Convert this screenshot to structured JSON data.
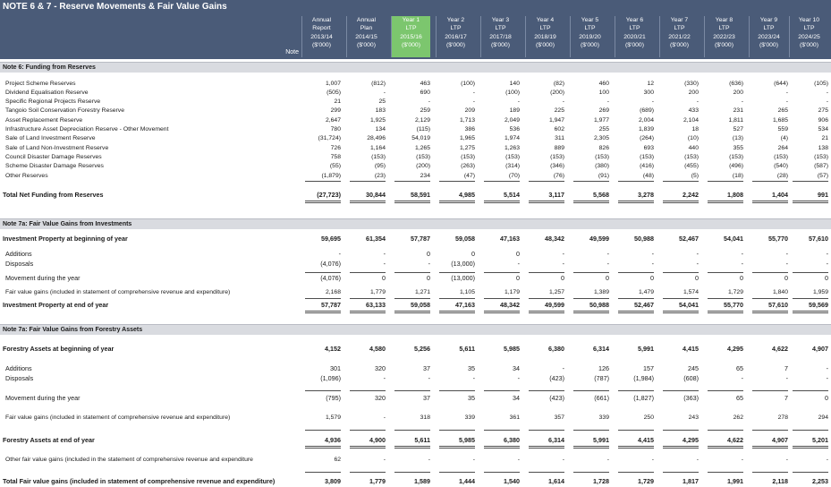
{
  "title": "NOTE 6 & 7 - Reserve Movements & Fair Value Gains",
  "note_header": "Note",
  "columns": [
    {
      "l1": "Annual",
      "l2": "Report",
      "l3": "2013/14",
      "l4": "($'000)"
    },
    {
      "l1": "Annual",
      "l2": "Plan",
      "l3": "2014/15",
      "l4": "($'000)"
    },
    {
      "l1": "Year 1",
      "l2": "LTP",
      "l3": "2015/16",
      "l4": "($'000)"
    },
    {
      "l1": "Year 2",
      "l2": "LTP",
      "l3": "2016/17",
      "l4": "($'000)"
    },
    {
      "l1": "Year 3",
      "l2": "LTP",
      "l3": "2017/18",
      "l4": "($'000)"
    },
    {
      "l1": "Year 4",
      "l2": "LTP",
      "l3": "2018/19",
      "l4": "($'000)"
    },
    {
      "l1": "Year 5",
      "l2": "LTP",
      "l3": "2019/20",
      "l4": "($'000)"
    },
    {
      "l1": "Year 6",
      "l2": "LTP",
      "l3": "2020/21",
      "l4": "($'000)"
    },
    {
      "l1": "Year 7",
      "l2": "LTP",
      "l3": "2021/22",
      "l4": "($'000)"
    },
    {
      "l1": "Year 8",
      "l2": "LTP",
      "l3": "2022/23",
      "l4": "($'000)"
    },
    {
      "l1": "Year 9",
      "l2": "LTP",
      "l3": "2023/24",
      "l4": "($'000)"
    },
    {
      "l1": "Year 10",
      "l2": "LTP",
      "l3": "2024/25",
      "l4": "($'000)"
    }
  ],
  "sections": [
    {
      "title": "Note 6:  Funding from Reserves"
    },
    {
      "title": "Note 7a:  Fair Value Gains from Investments"
    },
    {
      "title": "Note 7a:  Fair Value Gains from Forestry Assets"
    }
  ],
  "rows": [
    {
      "label": "Project Scheme Reserves",
      "values": [
        "1,007",
        "(812)",
        "463",
        "(100)",
        "140",
        "(82)",
        "460",
        "12",
        "(330)",
        "(636)",
        "(644)",
        "(105)"
      ]
    },
    {
      "label": "Dividend Equalisation Reserve",
      "values": [
        "(505)",
        "-",
        "690",
        "-",
        "(100)",
        "(200)",
        "100",
        "300",
        "200",
        "200",
        "-",
        "-"
      ]
    },
    {
      "label": "Specific Regional Projects Reserve",
      "values": [
        "21",
        "25",
        "-",
        "-",
        "-",
        "-",
        "-",
        "-",
        "-",
        "-",
        "-",
        "-"
      ]
    },
    {
      "label": "Tangoio Soil Conservation Forestry Reserve",
      "values": [
        "299",
        "183",
        "259",
        "209",
        "189",
        "225",
        "269",
        "(689)",
        "433",
        "231",
        "265",
        "275"
      ]
    },
    {
      "label": "Asset Replacement Reserve",
      "values": [
        "2,647",
        "1,925",
        "2,129",
        "1,713",
        "2,049",
        "1,947",
        "1,977",
        "2,004",
        "2,104",
        "1,811",
        "1,685",
        "906"
      ]
    },
    {
      "label": "Infrastructure Asset Depreciation Reserve - Other Movement",
      "values": [
        "780",
        "134",
        "(115)",
        "386",
        "536",
        "602",
        "255",
        "1,839",
        "18",
        "527",
        "559",
        "534"
      ]
    },
    {
      "label": "Sale of Land Investment Reserve",
      "values": [
        "(31,724)",
        "28,496",
        "54,019",
        "1,965",
        "1,974",
        "311",
        "2,305",
        "(264)",
        "(10)",
        "(13)",
        "(4)",
        "21"
      ]
    },
    {
      "label": "Sale of Land Non-Investment Reserve",
      "values": [
        "726",
        "1,164",
        "1,265",
        "1,275",
        "1,263",
        "889",
        "826",
        "693",
        "440",
        "355",
        "264",
        "138"
      ]
    },
    {
      "label": "Council Disaster Damage Reserves",
      "values": [
        "758",
        "(153)",
        "(153)",
        "(153)",
        "(153)",
        "(153)",
        "(153)",
        "(153)",
        "(153)",
        "(153)",
        "(153)",
        "(153)"
      ]
    },
    {
      "label": "Scheme Disaster Damage Reserves",
      "values": [
        "(55)",
        "(95)",
        "(200)",
        "(263)",
        "(314)",
        "(346)",
        "(380)",
        "(416)",
        "(455)",
        "(496)",
        "(540)",
        "(587)"
      ]
    },
    {
      "label": "Other Reserves",
      "values": [
        "(1,879)",
        "(23)",
        "234",
        "(47)",
        "(70)",
        "(76)",
        "(91)",
        "(48)",
        "(5)",
        "(18)",
        "(28)",
        "(57)"
      ]
    },
    {
      "label": "Total Net Funding from Reserves",
      "values": [
        "(27,723)",
        "30,844",
        "58,591",
        "4,985",
        "5,514",
        "3,117",
        "5,568",
        "3,278",
        "2,242",
        "1,808",
        "1,404",
        "991"
      ]
    },
    {
      "label": "Investment Property at beginning of year",
      "values": [
        "59,695",
        "61,354",
        "57,787",
        "59,058",
        "47,163",
        "48,342",
        "49,599",
        "50,988",
        "52,467",
        "54,041",
        "55,770",
        "57,610"
      ]
    },
    {
      "label": "Additions",
      "values": [
        "-",
        "-",
        "0",
        "0",
        "0",
        "-",
        "-",
        "-",
        "-",
        "-",
        "-",
        "-"
      ]
    },
    {
      "label": "Disposals",
      "values": [
        "(4,076)",
        "-",
        "-",
        "(13,000)",
        "-",
        "-",
        "-",
        "-",
        "-",
        "-",
        "-",
        "-"
      ]
    },
    {
      "label": "Movement during the year",
      "values": [
        "(4,076)",
        "0",
        "0",
        "(13,000)",
        "0",
        "0",
        "0",
        "0",
        "0",
        "0",
        "0",
        "0"
      ]
    },
    {
      "label": "Fair value gains (included in statement of comprehensive revenue and expenditure)",
      "values": [
        "2,168",
        "1,779",
        "1,271",
        "1,105",
        "1,179",
        "1,257",
        "1,389",
        "1,479",
        "1,574",
        "1,729",
        "1,840",
        "1,959"
      ]
    },
    {
      "label": "Investment Property at end of year",
      "values": [
        "57,787",
        "63,133",
        "59,058",
        "47,163",
        "48,342",
        "49,599",
        "50,988",
        "52,467",
        "54,041",
        "55,770",
        "57,610",
        "59,569"
      ]
    },
    {
      "label": "Forestry Assets at beginning of year",
      "values": [
        "4,152",
        "4,580",
        "5,256",
        "5,611",
        "5,985",
        "6,380",
        "6,314",
        "5,991",
        "4,415",
        "4,295",
        "4,622",
        "4,907"
      ]
    },
    {
      "label": "Additions",
      "values": [
        "301",
        "320",
        "37",
        "35",
        "34",
        "-",
        "126",
        "157",
        "245",
        "65",
        "7",
        "-"
      ]
    },
    {
      "label": "Disposals",
      "values": [
        "(1,096)",
        "-",
        "-",
        "-",
        "-",
        "(423)",
        "(787)",
        "(1,984)",
        "(608)",
        "-",
        "-",
        "-"
      ]
    },
    {
      "label": "Movement during the year",
      "values": [
        "(795)",
        "320",
        "37",
        "35",
        "34",
        "(423)",
        "(661)",
        "(1,827)",
        "(363)",
        "65",
        "7",
        "0"
      ]
    },
    {
      "label": "Fair value gains (included in statement of comprehensive revenue and expenditure)",
      "values": [
        "1,579",
        "-",
        "318",
        "339",
        "361",
        "357",
        "339",
        "250",
        "243",
        "262",
        "278",
        "294"
      ]
    },
    {
      "label": "Forestry Assets at end of year",
      "values": [
        "4,936",
        "4,900",
        "5,611",
        "5,985",
        "6,380",
        "6,314",
        "5,991",
        "4,415",
        "4,295",
        "4,622",
        "4,907",
        "5,201"
      ]
    },
    {
      "label": "Other fair value gains (included in the statement of comprehensive revenue and expenditure",
      "values": [
        "62",
        "-",
        "-",
        "-",
        "-",
        "-",
        "-",
        "-",
        "-",
        "-",
        "-",
        "-"
      ]
    },
    {
      "label": "Total Fair value gains (included in statement of comprehensive revenue and expenditure)",
      "values": [
        "3,809",
        "1,779",
        "1,589",
        "1,444",
        "1,540",
        "1,614",
        "1,728",
        "1,729",
        "1,817",
        "1,991",
        "2,118",
        "2,253"
      ]
    }
  ]
}
